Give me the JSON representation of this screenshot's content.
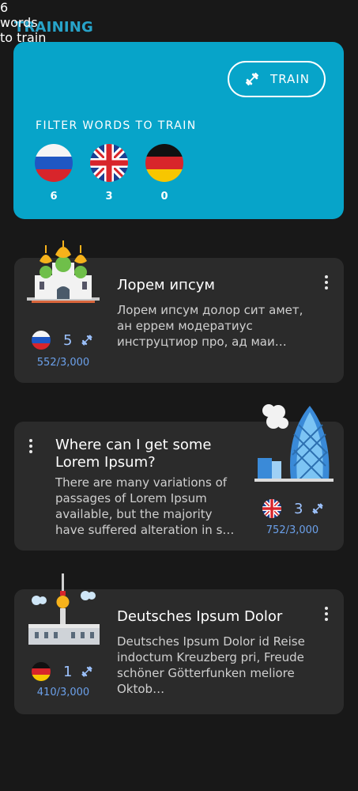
{
  "section": {
    "title": "TRAINING"
  },
  "hero": {
    "count": "6",
    "words_label": "words",
    "to_train_label": "to train",
    "train_button": "TRAIN",
    "filter_title": "FILTER WORDS TO TRAIN",
    "flags": [
      {
        "lang": "Russian",
        "count": "6"
      },
      {
        "lang": "English",
        "count": "3"
      },
      {
        "lang": "German",
        "count": "0"
      }
    ]
  },
  "cards": [
    {
      "title": "Лорем ипсум",
      "description": "Лорем ипсум долор сит амет, ан еррем модератиус инструцтиор про, ад маи…",
      "lang": "Russian",
      "to_train": "5",
      "progress": "552/3,000",
      "illustration": "church-icon"
    },
    {
      "title": "Where can I get some Lorem Ipsum?",
      "description": "There are many variations of passages of Lorem Ipsum available, but the majority have suffered alteration in s…",
      "lang": "English",
      "to_train": "3",
      "progress": "752/3,000",
      "illustration": "skyscraper-icon"
    },
    {
      "title": "Deutsches Ipsum Dolor",
      "description": "Deutsches Ipsum Dolor id Reise indoctum Kreuzberg pri, Freude schöner Götterfunken meliore Oktob…",
      "lang": "German",
      "to_train": "1",
      "progress": "410/3,000",
      "illustration": "tv-tower-icon"
    }
  ],
  "colors": {
    "background": "#181818",
    "accent": "#07a4c9",
    "card": "#2b2b2b",
    "progress": "#6ba0ea"
  }
}
